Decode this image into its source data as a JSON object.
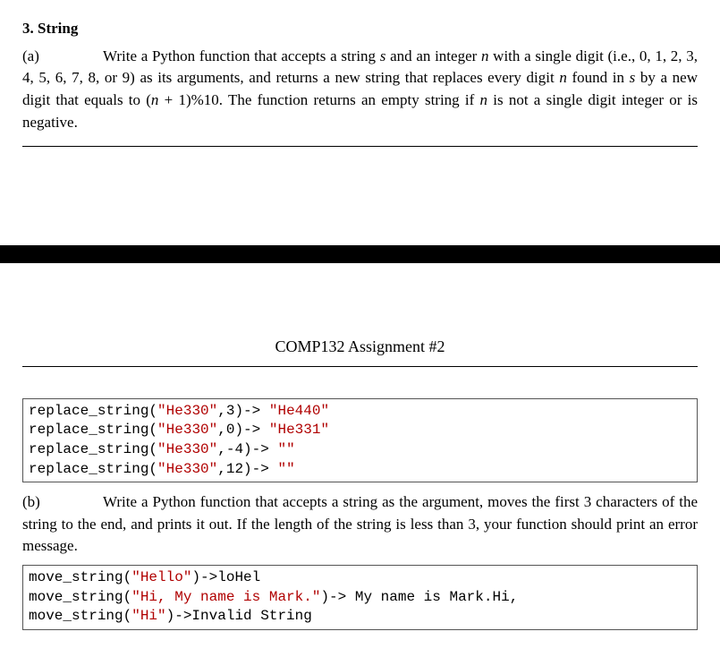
{
  "section": {
    "number": "3.",
    "title": "String"
  },
  "partA": {
    "label": "(a)",
    "textBefore": "Write a Python function that accepts a string ",
    "var_s": "s",
    "mid1": " and an integer ",
    "var_n1": "n",
    "mid2": " with a single digit (i.e., 0, 1, 2, 3, 4, 5, 6, 7, 8, or 9) as its arguments, and returns a new string that replaces every digit ",
    "var_n2": "n",
    "mid3": " found in ",
    "var_s2": "s",
    "mid4": " by a new digit that equals to (",
    "expr_n": "n",
    "mid5": " + 1)%10. The function returns an empty string if ",
    "var_n3": "n",
    "mid6": " is not a single digit integer or is negative."
  },
  "pageHeader": "COMP132  Assignment #2",
  "codeA": {
    "l1a": "replace_string(",
    "l1q1": "\"He330\"",
    "l1b": ",3)-> ",
    "l1q2": "\"He440\"",
    "l2a": "replace_string(",
    "l2q1": "\"He330\"",
    "l2b": ",0)-> ",
    "l2q2": "\"He331\"",
    "l3a": "replace_string(",
    "l3q1": "\"He330\"",
    "l3b": ",-4)-> ",
    "l3q2": "\"\"",
    "l4a": "replace_string(",
    "l4q1": "\"He330\"",
    "l4b": ",12)-> ",
    "l4q2": "\"\""
  },
  "partB": {
    "label": "(b)",
    "text": "Write a Python function that accepts a string as the argument, moves the first 3 characters of the string to the end, and prints it out. If the length of the string is less than 3, your function should print an error message."
  },
  "codeB": {
    "l1a": "move_string(",
    "l1q": "\"Hello\"",
    "l1b": ")->loHel",
    "l2a": "move_string(",
    "l2q": "\"Hi, My name is Mark.\"",
    "l2b": ")-> My name is Mark.Hi,",
    "l3a": "move_string(",
    "l3q": "\"Hi\"",
    "l3b": ")->Invalid String"
  }
}
